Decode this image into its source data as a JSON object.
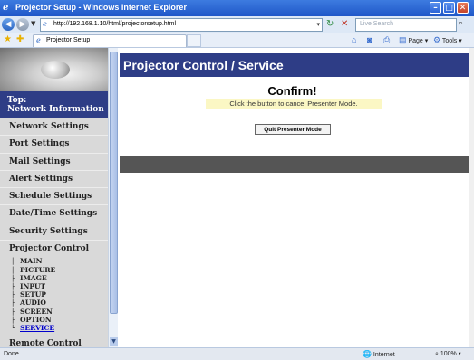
{
  "window": {
    "title": "Projector Setup - Windows Internet Explorer"
  },
  "address_bar": {
    "url": "http://192.168.1.10/html/projectorsetup.html",
    "search_placeholder": "Live Search"
  },
  "tab": {
    "label": "Projector Setup"
  },
  "command_bar": {
    "page": "Page",
    "tools": "Tools"
  },
  "sidebar": {
    "top_label_line1": "Top:",
    "top_label_line2": "Network Information",
    "items": [
      "Network Settings",
      "Port Settings",
      "Mail Settings",
      "Alert Settings",
      "Schedule Settings",
      "Date/Time Settings",
      "Security Settings"
    ],
    "projector_control": {
      "label": "Projector Control",
      "sub_items": [
        "MAIN",
        "PICTURE",
        "IMAGE",
        "INPUT",
        "SETUP",
        "AUDIO",
        "SCREEN",
        "OPTION",
        "SERVICE"
      ],
      "active": "SERVICE"
    },
    "remote_control": "Remote Control"
  },
  "main": {
    "header": "Projector Control / Service",
    "confirm_title": "Confirm!",
    "confirm_message": "Click the button to cancel Presenter Mode.",
    "quit_button": "Quit Presenter Mode"
  },
  "status_bar": {
    "status": "Done",
    "zone": "Internet",
    "zoom": "100%"
  }
}
